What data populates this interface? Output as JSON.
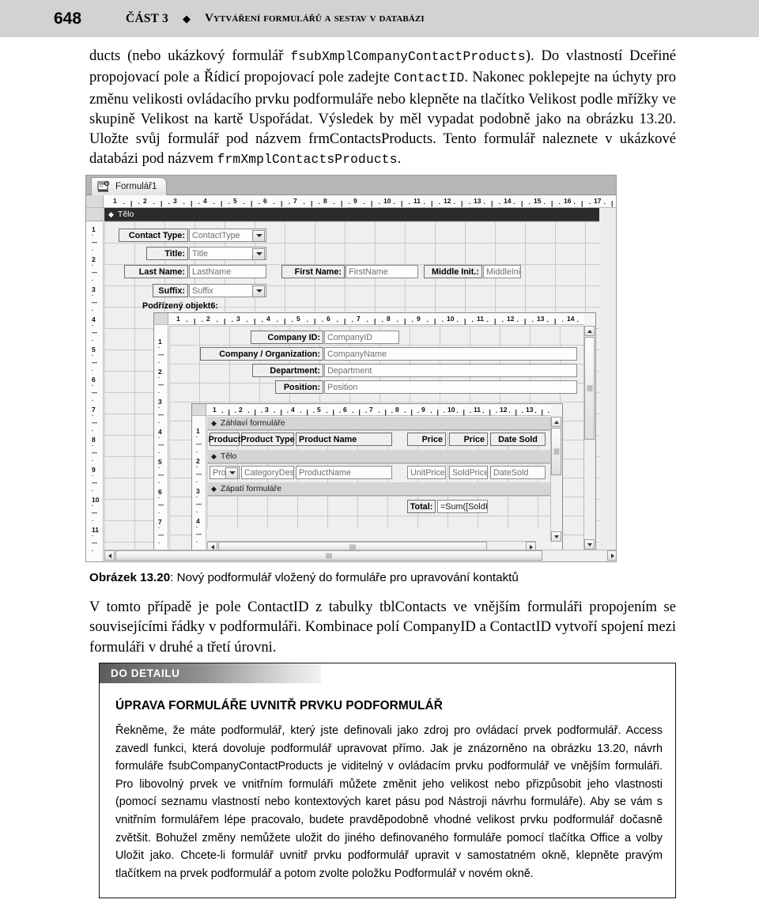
{
  "running_head": {
    "page_number": "648",
    "part": "Část 3",
    "diamond": "◆",
    "title": "Vytváření formulářů a sestav v databázi"
  },
  "body": {
    "para1_a": "ducts (nebo ukázkový formulář ",
    "para1_code1": "fsubXmplCompanyContactProducts",
    "para1_b": "). Do vlastností Dceřiné propojovací pole a Řídicí propojovací pole zadejte ",
    "para1_code2": "ContactID",
    "para1_c": ". Nakonec poklepejte na úchyty pro změnu velikosti ovládacího prvku podformuláře nebo klepněte na tlačítko Velikost podle mřížky ve skupině Velikost na kartě Uspořádat. Výsledek by měl vypadat podobně jako na obrázku 13.20. Uložte svůj formulář pod názvem frmContactsProducts. Tento formulář naleznete v ukázkové databázi pod názvem ",
    "para1_code3": "frmXmplContactsProducts",
    "para1_d": "."
  },
  "screenshot": {
    "tab_label": "Formulář1",
    "tab_icon": "form-design-icon",
    "outer_ruler_numbers": [
      "1",
      "2",
      "3",
      "4",
      "5",
      "6",
      "7",
      "8",
      "9",
      "10",
      "11",
      "12",
      "13",
      "14",
      "15",
      "16",
      "17"
    ],
    "outer_vruler_numbers": [
      "1",
      "2",
      "3",
      "4",
      "5",
      "6",
      "7",
      "8",
      "9",
      "10",
      "11"
    ],
    "section_body": "Tělo",
    "section_form_header": "Záhlaví formuláře",
    "section_form_footer": "Zápatí formuláře",
    "level1_controls": [
      {
        "label": "Contact Type:",
        "field": "ContactType",
        "type": "combo"
      },
      {
        "label": "Title:",
        "field": "Title",
        "type": "combo"
      },
      {
        "label": "Last Name:",
        "field": "LastName",
        "type": "text"
      },
      {
        "label": "First Name:",
        "field": "FirstName",
        "type": "text"
      },
      {
        "label": "Middle Init.:",
        "field": "MiddleInit",
        "type": "text"
      },
      {
        "label": "Suffix:",
        "field": "Suffix",
        "type": "combo"
      }
    ],
    "subform_label": "Podřízený objekt6:",
    "level2_controls": [
      {
        "label": "Company ID:",
        "field": "CompanyID"
      },
      {
        "label": "Company / Organization:",
        "field": "CompanyName"
      },
      {
        "label": "Department:",
        "field": "Department"
      },
      {
        "label": "Position:",
        "field": "Position"
      }
    ],
    "level3_header_labels": [
      "Product",
      "Product Type",
      "Product Name",
      "Price",
      "Price",
      "Date Sold"
    ],
    "level3_detail_fields": [
      "Produ",
      "CategoryDescripl",
      "ProductName",
      "UnitPrice",
      "SoldPrice",
      "DateSold"
    ],
    "level3_footer_label": "Total:",
    "level3_footer_field": "=Sum([SoldF"
  },
  "figure_caption": {
    "number": "Obrázek 13.20",
    "separator": ": ",
    "text": "Nový podformulář vložený do formuláře pro upravování kontaktů"
  },
  "after_figure": {
    "text": "V tomto případě je pole ContactID z tabulky tblContacts ve vnějším formuláři propojením se souvisejícími řádky v podformuláři. Kombinace polí CompanyID a ContactID vytvoří spojení mezi formuláři v druhé a třetí úrovni."
  },
  "sidebar": {
    "banner": "DO DETAILU",
    "title": "ÚPRAVA FORMULÁŘE UVNITŘ PRVKU PODFORMULÁŘ",
    "body": "Řekněme, že máte podformulář, který jste definovali jako zdroj pro ovládací prvek podformulář. Access  zavedl funkci, která dovoluje podformulář upravovat přímo. Jak je znázorněno na obrázku 13.20, návrh formuláře fsubCompanyContactProducts je viditelný v ovládacím prvku podformulář ve vnějším formuláři. Pro libovolný prvek ve vnitřním formuláři můžete změnit jeho velikost nebo přizpůsobit jeho vlastnosti (pomocí seznamu vlastností nebo kontextových karet pásu pod Nástroji návrhu formuláře). Aby se vám s vnitřním formulářem lépe pracovalo, budete pravděpodobně vhodné velikost prvku podformulář dočasně zvětšit.  Bohužel změny nemůžete uložit do jiného definovaného formuláře pomocí tlačítka Office a volby Uložit jako. Chcete-li formulář uvnitř prvku podformulář upravit v samostatném okně, klepněte pravým tlačítkem na prvek podformulář a potom zvolte položku Podformulář v novém okně."
  },
  "colors": {
    "running_head_bg": "#d2d2d2",
    "section_bar_dark": "#2b2b2b",
    "section_bar_light": "#d5d5d5",
    "canvas": "#efefef",
    "page_bg": "#ffffff"
  }
}
